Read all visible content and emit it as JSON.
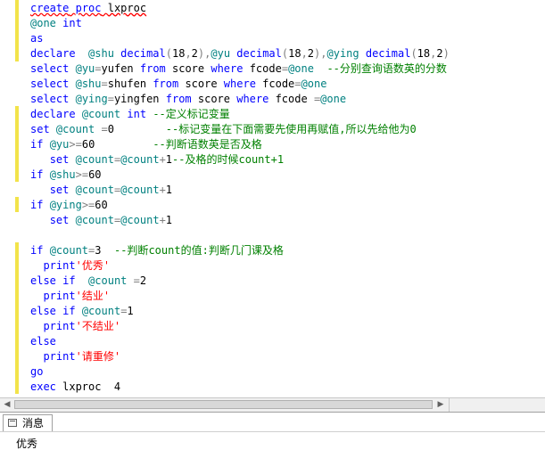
{
  "editor": {
    "lines": [
      "create proc lxproc",
      "@one int",
      "as",
      "declare  @shu decimal(18,2),@yu decimal(18,2),@ying decimal(18,2)",
      "select @yu=yufen from score where fcode=@one  --分别查询语数英的分数",
      "select @shu=shufen from score where fcode=@one",
      "select @ying=yingfen from score where fcode =@one",
      "declare @count int --定义标记变量",
      "set @count =0        --标记变量在下面需要先使用再赋值,所以先给他为0",
      "if @yu>=60         --判断语数英是否及格",
      "   set @count=@count+1--及格的时候count+1",
      "if @shu>=60",
      "   set @count=@count+1",
      "if @ying>=60",
      "   set @count=@count+1",
      "",
      "if @count=3  --判断count的值:判断几门课及格",
      "  print'优秀'",
      "else if  @count =2",
      "  print'结业'",
      "else if @count=1",
      "  print'不结业'",
      "else",
      "  print'请重修'",
      "go",
      "exec lxproc  4"
    ]
  },
  "results": {
    "tab_label": "消息",
    "message": "优秀"
  }
}
